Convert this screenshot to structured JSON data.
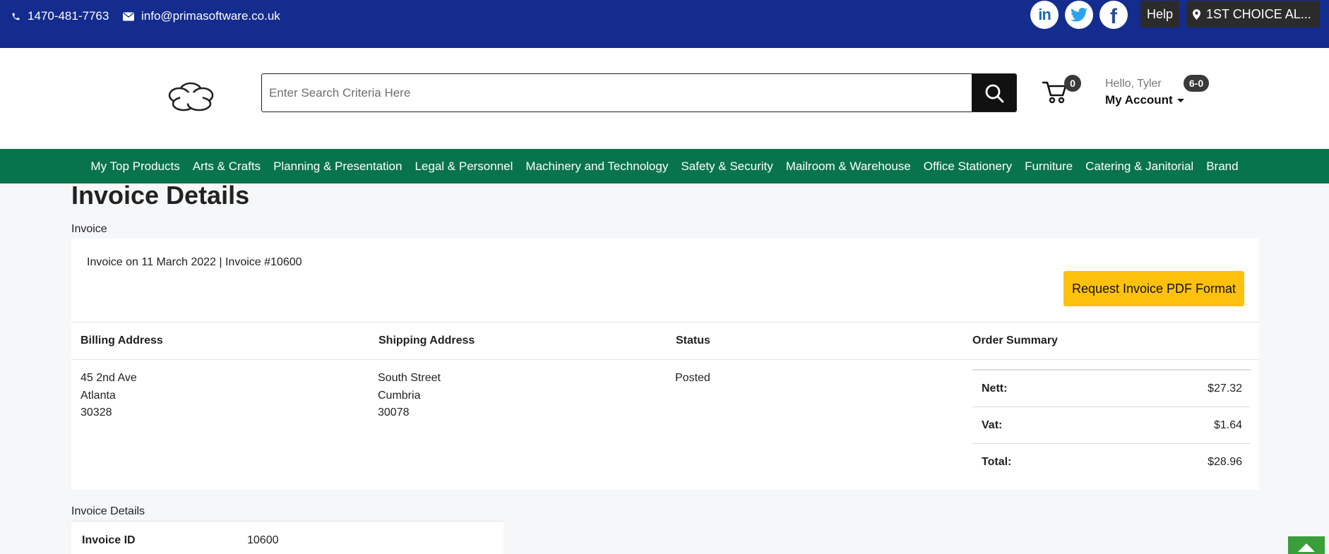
{
  "topbar": {
    "phone": "1470-481-7763",
    "email": "info@primasoftware.co.uk",
    "social": [
      "linkedin-icon",
      "twitter-icon",
      "facebook-icon"
    ],
    "help_label": "Help",
    "branch_label": "1ST CHOICE AL..."
  },
  "header": {
    "search_placeholder": "Enter Search Criteria Here",
    "cart_count": "0",
    "greeting": "Hello, Tyler",
    "account_label": "My Account",
    "account_badge": "6-0"
  },
  "nav": {
    "items": [
      "My Top Products",
      "Arts & Crafts",
      "Planning & Presentation",
      "Legal & Personnel",
      "Machinery and Technology",
      "Safety & Security",
      "Mailroom & Warehouse",
      "Office Stationery",
      "Furniture",
      "Catering & Janitorial",
      "Brand"
    ]
  },
  "page": {
    "title": "Invoice Details",
    "breadcrumb": "Invoice"
  },
  "invoice": {
    "summary_line": "Invoice on 11 March 2022 | Invoice #10600",
    "pdf_button": "Request Invoice PDF Format",
    "headers": {
      "billing": "Billing Address",
      "shipping": "Shipping Address",
      "status": "Status",
      "order_summary": "Order Summary"
    },
    "billing": {
      "line1": "45 2nd Ave",
      "line2": "Atlanta",
      "line3": "30328"
    },
    "shipping": {
      "line1": "South Street",
      "line2": "Cumbria",
      "line3": "30078"
    },
    "status": "Posted",
    "summary": {
      "nett_label": "Nett:",
      "nett_value": "$27.32",
      "vat_label": "Vat:",
      "vat_value": "$1.64",
      "total_label": "Total:",
      "total_value": "$28.96"
    }
  },
  "details": {
    "label": "Invoice Details",
    "id_label": "Invoice ID",
    "id_value": "10600"
  },
  "colors": {
    "topbar": "#142c8e",
    "nav": "#08744b",
    "accent_button": "#fec10e"
  }
}
